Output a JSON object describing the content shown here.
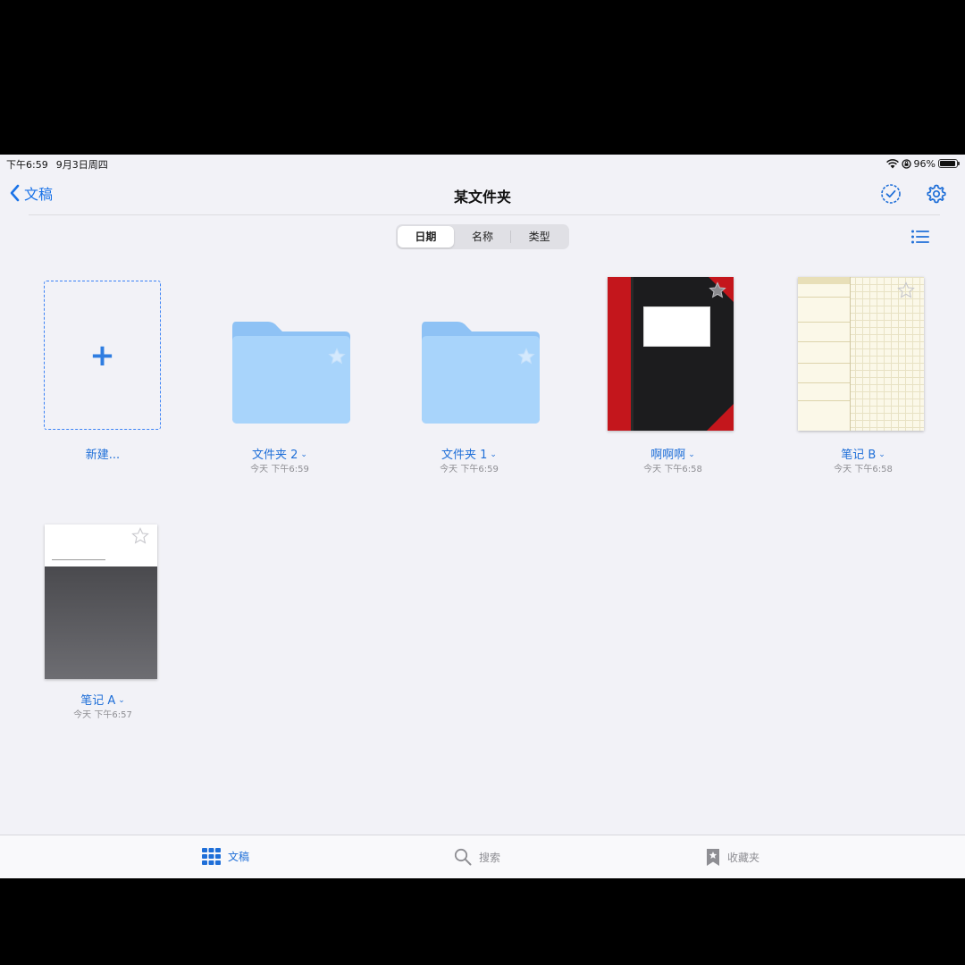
{
  "status_bar": {
    "time": "下午6:59",
    "date": "9月3日周四",
    "battery": "96%",
    "battery_level": 0.96
  },
  "nav": {
    "back_label": "文稿",
    "title": "某文件夹",
    "icons": [
      "chevron-left-icon",
      "checkmark-circle-icon",
      "gear-icon"
    ]
  },
  "sort": {
    "options": [
      "日期",
      "名称",
      "类型"
    ],
    "selected": "日期"
  },
  "items": [
    {
      "kind": "new",
      "label": "新建..."
    },
    {
      "kind": "folder",
      "label": "文件夹 2",
      "date": "今天 下午6:59"
    },
    {
      "kind": "folder",
      "label": "文件夹 1",
      "date": "今天 下午6:59"
    },
    {
      "kind": "notebook",
      "label": "啊啊啊",
      "date": "今天 下午6:58"
    },
    {
      "kind": "notebook",
      "label": "笔记 B",
      "date": "今天 下午6:58"
    },
    {
      "kind": "notebook",
      "label": "笔记 A",
      "date": "今天 下午6:57"
    }
  ],
  "tabs": [
    {
      "label": "文稿",
      "icon": "grid-icon",
      "active": true
    },
    {
      "label": "搜索",
      "icon": "search-icon",
      "active": false
    },
    {
      "label": "收藏夹",
      "icon": "bookmark-star-icon",
      "active": false
    }
  ],
  "colors": {
    "accent": "#1f6fd8",
    "background": "#f2f2f7",
    "folder": "#a8d4fb",
    "notebook_red": "#c4161c"
  }
}
